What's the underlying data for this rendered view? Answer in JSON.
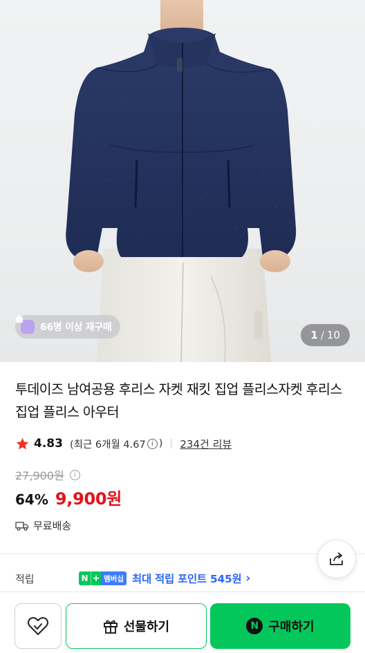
{
  "hero": {
    "rebuy_badge": "66명 이상 재구매",
    "counter": {
      "current": "1",
      "total": "10"
    }
  },
  "product": {
    "title": "투데이즈 남여공용 후리스 자켓 재킷 집업 플리스자켓 후리스집업 플리스 아우터",
    "rating": "4.83",
    "recent_rating": "(최근 6개월 4.67",
    "recent_close": ")",
    "review_count": "234건 리뷰",
    "original_price": "27,900원",
    "discount": "64%",
    "price": "9,900원",
    "shipping": "무료배송"
  },
  "points": {
    "label": "적립",
    "badge_n": "N",
    "badge_plus": "+",
    "badge_text": "멤버십",
    "text": "최대 적립 포인트 545원",
    "chevron": "›"
  },
  "bottom_bar": {
    "gift_label": "선물하기",
    "buy_label": "구매하기",
    "buy_n": "N"
  },
  "icons": [
    "purchase-bag-icon",
    "star-icon",
    "info-icon",
    "truck-icon",
    "share-icon",
    "heart-icon",
    "gift-icon"
  ],
  "colors": {
    "accent_green": "#03c75a",
    "price_red": "#e4111b",
    "points_blue": "#2f68f5",
    "star_red": "#f0311e"
  }
}
